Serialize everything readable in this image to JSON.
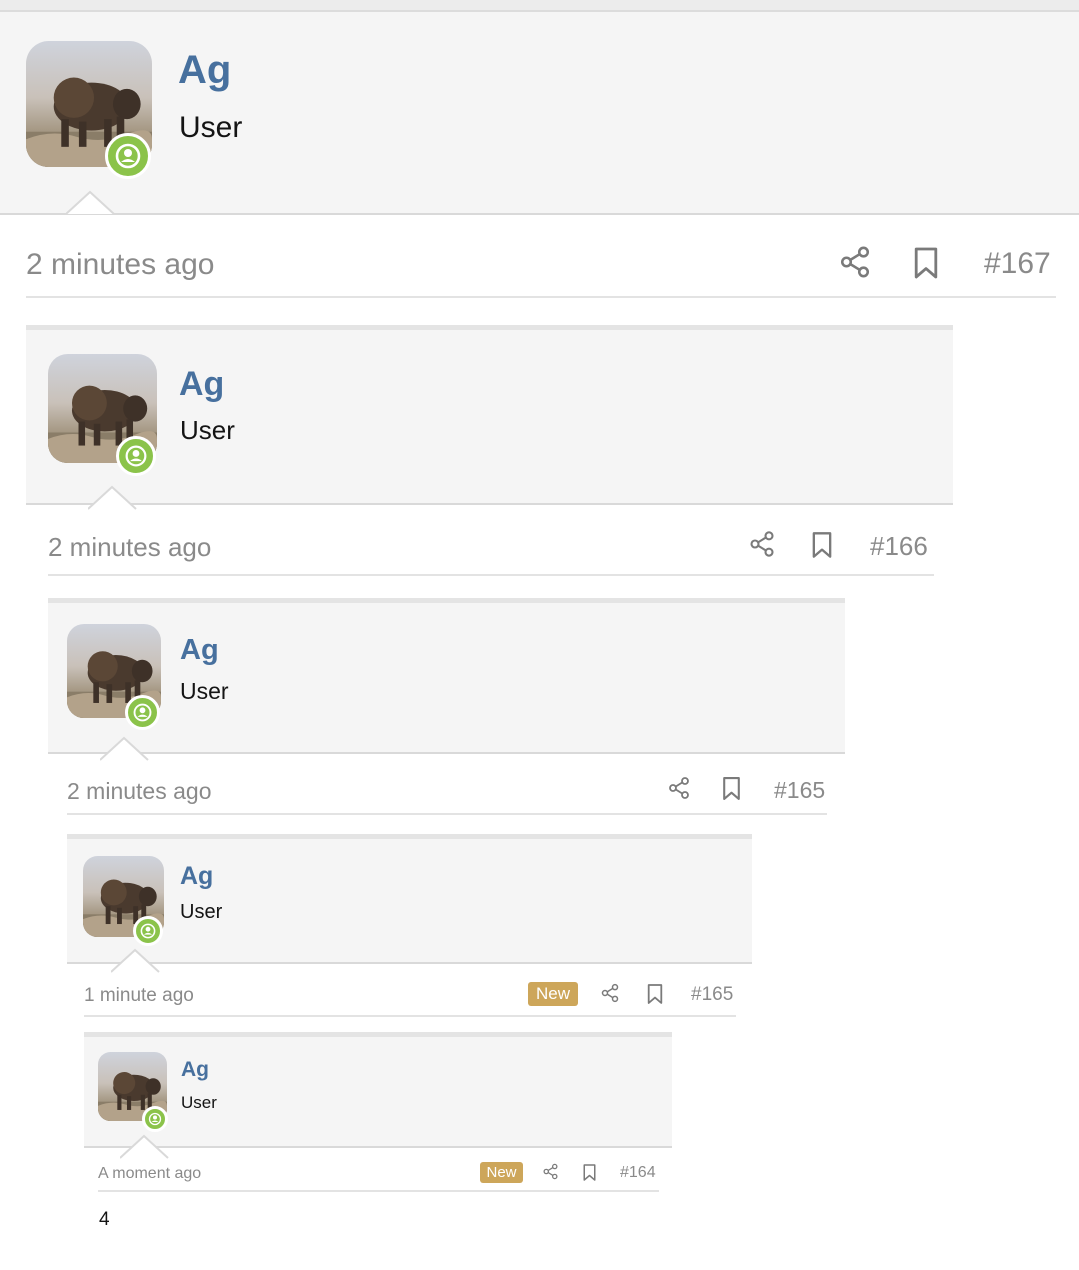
{
  "posts": [
    {
      "username": "Ag",
      "user_title": "User",
      "time": "2 minutes ago",
      "post_number": "#167",
      "badge": ""
    },
    {
      "username": "Ag",
      "user_title": "User",
      "time": "2 minutes ago",
      "post_number": "#166",
      "badge": ""
    },
    {
      "username": "Ag",
      "user_title": "User",
      "time": "2 minutes ago",
      "post_number": "#165",
      "badge": ""
    },
    {
      "username": "Ag",
      "user_title": "User",
      "time": "1 minute ago",
      "post_number": "#165",
      "badge": "New"
    },
    {
      "username": "Ag",
      "user_title": "User",
      "time": "A moment ago",
      "post_number": "#164",
      "badge": "New"
    }
  ],
  "last_post_body": "4",
  "colors": {
    "username": "#47709e",
    "online_status": "#8bc34a",
    "new_badge": "#cda65a"
  },
  "icons": {
    "share": "share-icon",
    "bookmark": "bookmark-icon",
    "status": "user-online-icon"
  }
}
